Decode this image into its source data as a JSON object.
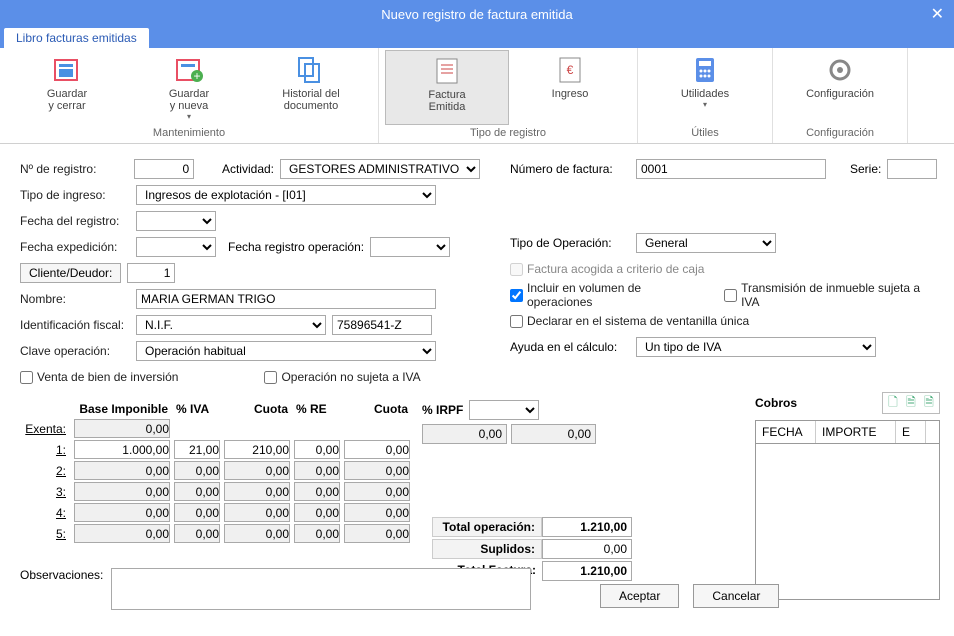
{
  "window": {
    "title": "Nuevo registro de factura emitida"
  },
  "tab": {
    "label": "Libro facturas emitidas"
  },
  "ribbon": {
    "guardar_cerrar": "Guardar\ny cerrar",
    "guardar_nueva": "Guardar\ny nueva",
    "historial": "Historial del\ndocumento",
    "factura_emitida": "Factura\nEmitida",
    "ingreso": "Ingreso",
    "utilidades": "Utilidades",
    "configuracion": "Configuración",
    "grp_mantenimiento": "Mantenimiento",
    "grp_tipo": "Tipo de registro",
    "grp_utiles": "Útiles",
    "grp_config": "Configuración"
  },
  "labels": {
    "nregistro": "Nº de registro:",
    "actividad": "Actividad:",
    "tipo_ingreso": "Tipo de ingreso:",
    "fecha_registro": "Fecha del registro:",
    "fecha_exped": "Fecha expedición:",
    "fecha_reg_op": "Fecha registro operación:",
    "cliente": "Cliente/Deudor:",
    "nombre": "Nombre:",
    "ident_fiscal": "Identificación fiscal:",
    "clave_op": "Clave operación:",
    "venta_inversion": "Venta de bien de inversión",
    "op_no_sujeta": "Operación no sujeta a IVA",
    "num_factura": "Número de factura:",
    "serie": "Serie:",
    "tipo_operacion": "Tipo de Operación:",
    "fact_acogida": "Factura acogida a criterio de caja",
    "incluir_vol": "Incluir en  volumen de operaciones",
    "trans_inmueble": "Transmisión de inmueble sujeta a IVA",
    "declarar_vent": "Declarar en el sistema de ventanilla única",
    "ayuda_calculo": "Ayuda en el cálculo:",
    "observaciones": "Observaciones:",
    "aceptar": "Aceptar",
    "cancelar": "Cancelar",
    "cobros": "Cobros",
    "fecha": "FECHA",
    "importe": "IMPORTE",
    "e": "E"
  },
  "values": {
    "nregistro": "0",
    "actividad": "GESTORES ADMINISTRATIVOS",
    "tipo_ingreso": "Ingresos de explotación - [I01]",
    "cliente_num": "1",
    "nombre": "MARIA GERMAN TRIGO",
    "ident_tipo": "N.I.F.",
    "ident_num": "75896541-Z",
    "clave_op": "Operación habitual",
    "num_factura": "0001",
    "tipo_operacion": "General",
    "ayuda_calculo": "Un tipo de IVA",
    "incluir_vol_checked": true
  },
  "tax": {
    "headers": {
      "base": "Base Imponible",
      "iva": "% IVA",
      "cuota": "Cuota",
      "re": "% RE",
      "cuota2": "Cuota",
      "irpf": "% IRPF"
    },
    "rows": [
      {
        "lbl": "Exenta:",
        "base": "0,00"
      },
      {
        "lbl": "1:",
        "base": "1.000,00",
        "iva": "21,00",
        "cuota": "210,00",
        "re": "0,00",
        "cuota2": "0,00"
      },
      {
        "lbl": "2:",
        "base": "0,00",
        "iva": "0,00",
        "cuota": "0,00",
        "re": "0,00",
        "cuota2": "0,00"
      },
      {
        "lbl": "3:",
        "base": "0,00",
        "iva": "0,00",
        "cuota": "0,00",
        "re": "0,00",
        "cuota2": "0,00"
      },
      {
        "lbl": "4:",
        "base": "0,00",
        "iva": "0,00",
        "cuota": "0,00",
        "re": "0,00",
        "cuota2": "0,00"
      },
      {
        "lbl": "5:",
        "base": "0,00",
        "iva": "0,00",
        "cuota": "0,00",
        "re": "0,00",
        "cuota2": "0,00"
      }
    ],
    "irpf_val1": "0,00",
    "irpf_val2": "0,00",
    "totals": {
      "total_op_lbl": "Total operación:",
      "total_op": "1.210,00",
      "suplidos_lbl": "Suplidos:",
      "suplidos": "0,00",
      "total_fact_lbl": "Total Factura:",
      "total_fact": "1.210,00"
    }
  }
}
